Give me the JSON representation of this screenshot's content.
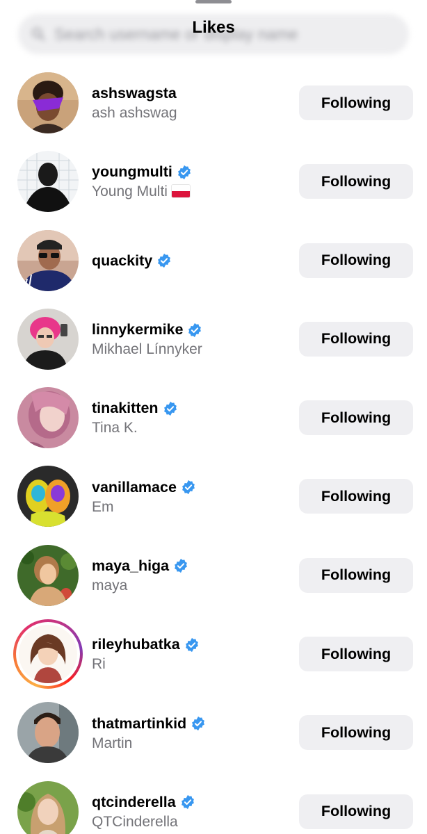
{
  "header": {
    "title": "Likes",
    "search_placeholder": "Search username or display name"
  },
  "colors": {
    "accent_verified": "#3897f0",
    "button_bg": "#efeff2",
    "secondary_text": "#737378"
  },
  "users": [
    {
      "username": "ashswagsta",
      "display_name": "ash ashswag",
      "verified": false,
      "button": "Following"
    },
    {
      "username": "youngmulti",
      "display_name": "Young Multi",
      "flag": "poland-flag",
      "verified": true,
      "button": "Following"
    },
    {
      "username": "quackity",
      "display_name": "",
      "verified": true,
      "button": "Following"
    },
    {
      "username": "linnykermike",
      "display_name": "Mikhael Línnyker",
      "verified": true,
      "button": "Following"
    },
    {
      "username": "tinakitten",
      "display_name": "Tina K.",
      "verified": true,
      "button": "Following"
    },
    {
      "username": "vanillamace",
      "display_name": "Em",
      "verified": true,
      "button": "Following"
    },
    {
      "username": "maya_higa",
      "display_name": "maya",
      "verified": true,
      "button": "Following"
    },
    {
      "username": "rileyhubatka",
      "display_name": "Ri",
      "verified": true,
      "story_ring": true,
      "button": "Following"
    },
    {
      "username": "thatmartinkid",
      "display_name": "Martin",
      "verified": true,
      "button": "Following"
    },
    {
      "username": "qtcinderella",
      "display_name": "QTCinderella",
      "verified": true,
      "button": "Following"
    }
  ]
}
